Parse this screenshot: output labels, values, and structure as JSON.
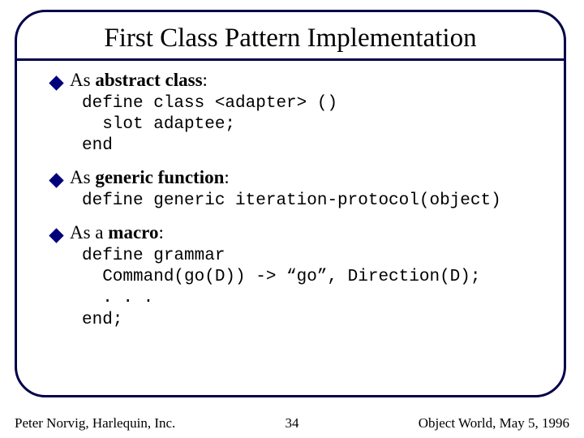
{
  "title": "First Class Pattern Implementation",
  "items": [
    {
      "lead": "As ",
      "bold": "abstract class",
      "tail": ":",
      "code": "define class <adapter> ()\n  slot adaptee;\nend"
    },
    {
      "lead": "As ",
      "bold": "generic function",
      "tail": ":",
      "code": "define generic iteration-protocol(object)"
    },
    {
      "lead": "As a ",
      "bold": "macro",
      "tail": ":",
      "code": "define grammar\n  Command(go(D)) -> “go”, Direction(D);\n  . . .\nend;"
    }
  ],
  "footer": {
    "left": "Peter Norvig, Harlequin, Inc.",
    "center": "34",
    "right": "Object World, May 5, 1996"
  }
}
